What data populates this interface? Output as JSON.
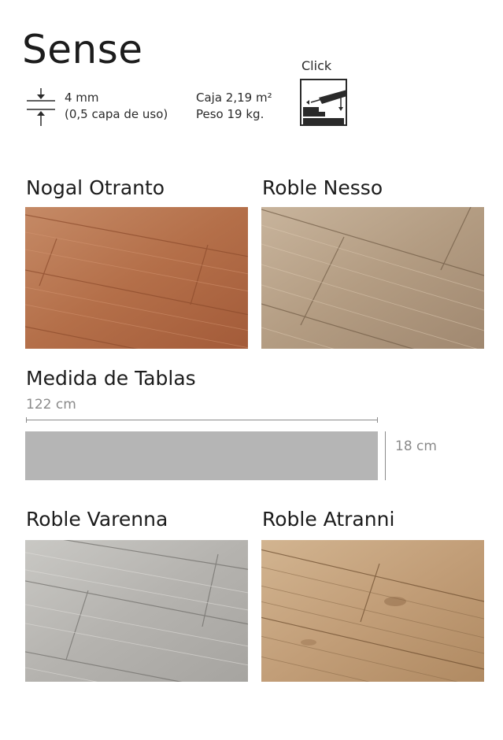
{
  "header": {
    "title": "Sense",
    "thickness_line1": "4 mm",
    "thickness_line2": "(0,5 capa de uso)",
    "box_line1": "Caja 2,19 m²",
    "box_line2": "Peso 19 kg.",
    "click_label": "Click",
    "thickness_icon": "thickness-arrows-icon",
    "click_icon": "click-lock-icon"
  },
  "products_top": [
    {
      "name": "Nogal Otranto",
      "tone": "#b9744f"
    },
    {
      "name": "Roble Nesso",
      "tone": "#b7a28a"
    }
  ],
  "dimensions": {
    "heading": "Medida de Tablas",
    "length": "122 cm",
    "width": "18 cm",
    "plank_color": "#b5b5b5"
  },
  "products_bottom": [
    {
      "name": "Roble Varenna",
      "tone": "#b4b2ae"
    },
    {
      "name": "Roble Atranni",
      "tone": "#c6a47e"
    }
  ]
}
